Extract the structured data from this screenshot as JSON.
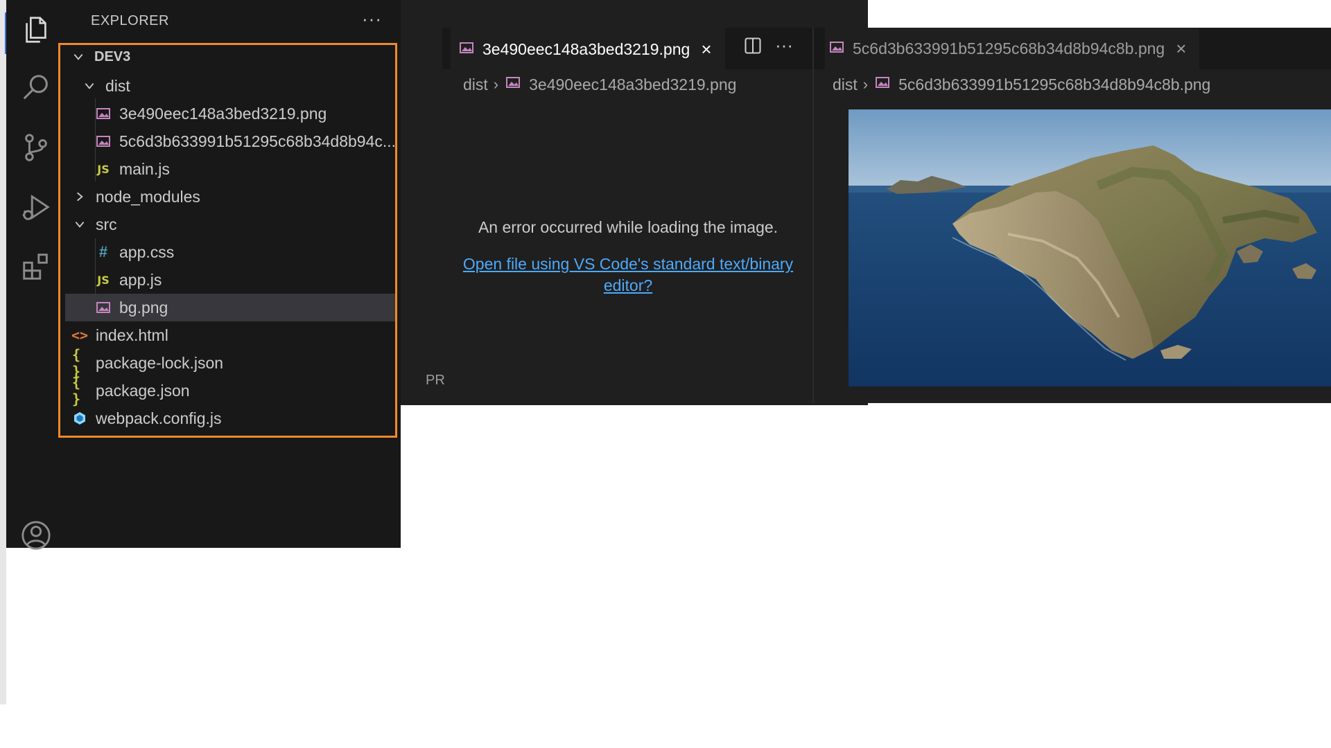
{
  "explorer": {
    "title": "EXPLORER",
    "more": "···",
    "root": "DEV3",
    "items": [
      {
        "label": "dist",
        "kind": "folder-open"
      },
      {
        "label": "3e490eec148a3bed3219.png",
        "kind": "image"
      },
      {
        "label": "5c6d3b633991b51295c68b34d8b94c...",
        "kind": "image"
      },
      {
        "label": "main.js",
        "kind": "js"
      },
      {
        "label": "node_modules",
        "kind": "folder-closed"
      },
      {
        "label": "src",
        "kind": "folder-open"
      },
      {
        "label": "app.css",
        "kind": "css"
      },
      {
        "label": "app.js",
        "kind": "js"
      },
      {
        "label": "bg.png",
        "kind": "image",
        "selected": true
      },
      {
        "label": "index.html",
        "kind": "html"
      },
      {
        "label": "package-lock.json",
        "kind": "json"
      },
      {
        "label": "package.json",
        "kind": "json"
      },
      {
        "label": "webpack.config.js",
        "kind": "webpack"
      }
    ],
    "icons": {
      "js": "JS",
      "css": "#",
      "json": "{ }",
      "html": "<>"
    }
  },
  "editor1": {
    "tab_label": "3e490eec148a3bed3219.png",
    "close": "×",
    "more": "···",
    "breadcrumb_folder": "dist",
    "breadcrumb_file": "3e490eec148a3bed3219.png",
    "error_message": "An error occurred while loading the image.",
    "open_link": "Open file using VS Code's standard text/binary editor?",
    "panel_label": "PR"
  },
  "editor2": {
    "tab_label": "5c6d3b633991b51295c68b34d8b94c8b.png",
    "close": "×",
    "breadcrumb_folder": "dist",
    "breadcrumb_file": "5c6d3b633991b51295c68b34d8b94c8b.png"
  },
  "colors": {
    "accent_outline": "#f08a2a",
    "link": "#4daafc",
    "image_icon": "#c586c0"
  }
}
